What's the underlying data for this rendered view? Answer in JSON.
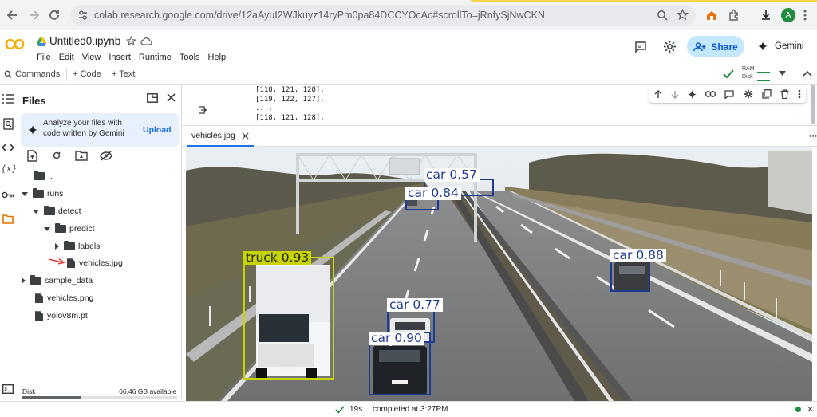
{
  "browser": {
    "url": "colab.research.google.com/drive/12aAyuI2WJkuyz14ryPm0pa84DCCYOcAc#scrollTo=jRnfySjNwCKN",
    "profile_initial": "A"
  },
  "app": {
    "logo_text": "CO",
    "notebook_title": "Untitled0.ipynb",
    "menus": [
      "File",
      "Edit",
      "View",
      "Insert",
      "Runtime",
      "Tools",
      "Help"
    ],
    "share_label": "Share",
    "gemini_label": "Gemini"
  },
  "toolbar": {
    "commands_label": "Commands",
    "add_code_label": "+ Code",
    "add_text_label": "+ Text",
    "ram_label": "RAM",
    "disk_label": "Disk"
  },
  "files_panel": {
    "title": "Files",
    "gemini_prompt": "Analyze your files with code written by Gemini",
    "upload_label": "Upload",
    "tree": [
      {
        "name": "..",
        "type": "folder",
        "depth": 0,
        "caret": "none"
      },
      {
        "name": "runs",
        "type": "folder",
        "depth": 0,
        "caret": "down"
      },
      {
        "name": "detect",
        "type": "folder",
        "depth": 1,
        "caret": "down"
      },
      {
        "name": "predict",
        "type": "folder",
        "depth": 2,
        "caret": "down"
      },
      {
        "name": "labels",
        "type": "folder",
        "depth": 3,
        "caret": "right"
      },
      {
        "name": "vehicles.jpg",
        "type": "file",
        "depth": 3,
        "caret": "none"
      },
      {
        "name": "sample_data",
        "type": "folder",
        "depth": 0,
        "caret": "right"
      },
      {
        "name": "vehicles.png",
        "type": "file",
        "depth": 0,
        "caret": "none"
      },
      {
        "name": "yolov8m.pt",
        "type": "file",
        "depth": 0,
        "caret": "none"
      }
    ],
    "disk_label": "Disk",
    "disk_available": "66.46 GB available",
    "disk_used_fraction": 0.38
  },
  "output": {
    "lines": [
      "[118, 121, 128],",
      "[119, 122, 127],",
      "...,",
      "[118, 121, 128],"
    ]
  },
  "viewer": {
    "tab_label": "vehicles.jpg",
    "detections": [
      {
        "label": "car 0.57",
        "color": "#1f3a93"
      },
      {
        "label": "car 0.84",
        "color": "#1f3a93"
      },
      {
        "label": "truck 0.93",
        "color": "#c8d400"
      },
      {
        "label": "car 0.88",
        "color": "#1f3a93"
      },
      {
        "label": "car 0.77",
        "color": "#1f3a93"
      },
      {
        "label": "car 0.90",
        "color": "#1f3a93"
      }
    ]
  },
  "status": {
    "elapsed": "19s",
    "completed": "completed at 3:27PM"
  }
}
